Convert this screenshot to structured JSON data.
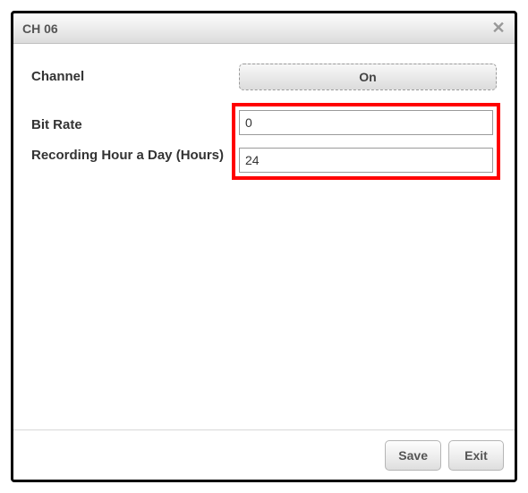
{
  "dialog": {
    "title": "CH 06"
  },
  "form": {
    "channel": {
      "label": "Channel",
      "value": "On"
    },
    "bitrate": {
      "label": "Bit Rate",
      "value": "0"
    },
    "recording": {
      "label": "Recording Hour a Day (Hours)",
      "value": "24"
    }
  },
  "buttons": {
    "save": "Save",
    "exit": "Exit"
  }
}
